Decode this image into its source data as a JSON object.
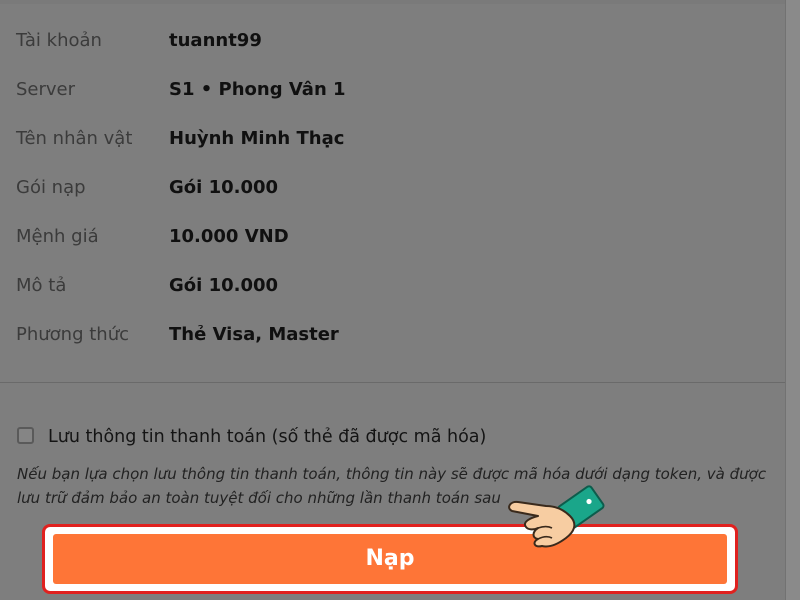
{
  "details": [
    {
      "label": "Tài khoản",
      "value": "tuannt99"
    },
    {
      "label": "Server",
      "value": "S1 • Phong Vân 1"
    },
    {
      "label": "Tên nhân vật",
      "value": "Huỳnh Minh Thạc"
    },
    {
      "label": "Gói nạp",
      "value": "Gói 10.000"
    },
    {
      "label": "Mệnh giá",
      "value": "10.000 VND"
    },
    {
      "label": "Mô tả",
      "value": "Gói 10.000"
    },
    {
      "label": "Phương thức",
      "value": "Thẻ Visa, Master"
    }
  ],
  "save_payment": {
    "checked": false,
    "label": "Lưu thông tin thanh toán (số thẻ đã được mã hóa)",
    "note_line1": "Nếu bạn lựa chọn lưu thông tin thanh toán, thông tin này sẽ được mã hóa dưới dạng token, và được",
    "note_line2": "lưu trữ đảm bảo an toàn tuyệt đối cho những lần thanh toán sau"
  },
  "submit_button": {
    "label": "Nạp"
  },
  "colors": {
    "overlay": "#7e7e7e",
    "button_fill": "#fe7537",
    "highlight_border": "#e0211f"
  },
  "icons": {
    "pointer": "pointing-hand-icon"
  }
}
